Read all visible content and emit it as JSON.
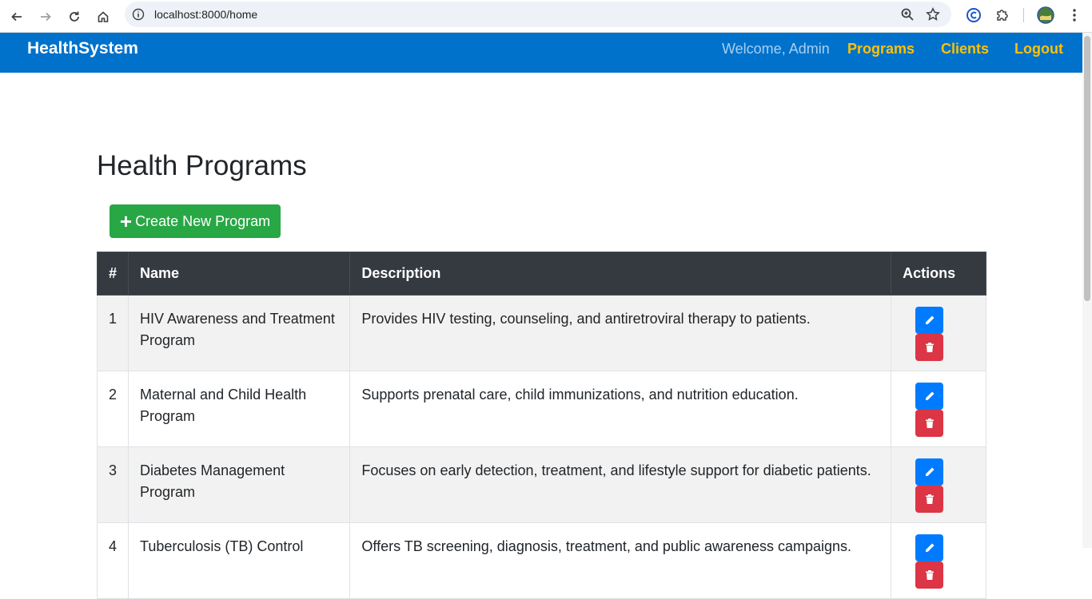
{
  "browser": {
    "url": "localhost:8000/home"
  },
  "navbar": {
    "brand": "HealthSystem",
    "welcome": "Welcome, Admin",
    "links": [
      {
        "label": "Programs"
      },
      {
        "label": "Clients"
      },
      {
        "label": "Logout"
      }
    ]
  },
  "main": {
    "title": "Health Programs",
    "create_button": {
      "icon": "plus-icon",
      "label": "Create New Program"
    },
    "table": {
      "headers": [
        "#",
        "Name",
        "Description",
        "Actions"
      ],
      "rows": [
        {
          "num": "1",
          "name": "HIV Awareness and Treatment Program",
          "description": "Provides HIV testing, counseling, and antiretroviral therapy to patients."
        },
        {
          "num": "2",
          "name": "Maternal and Child Health Program",
          "description": "Supports prenatal care, child immunizations, and nutrition education."
        },
        {
          "num": "3",
          "name": "Diabetes Management Program",
          "description": "Focuses on early detection, treatment, and lifestyle support for diabetic patients."
        },
        {
          "num": "4",
          "name": "Tuberculosis (TB) Control",
          "description": "Offers TB screening, diagnosis, treatment, and public awareness campaigns."
        }
      ],
      "action_icons": {
        "edit": "pencil-icon",
        "delete": "trash-icon"
      }
    }
  },
  "colors": {
    "navbar": "#0072cb",
    "nav_link": "#ffc107",
    "create_button": "#28a745",
    "table_header": "#343a40",
    "edit_button": "#007bff",
    "delete_button": "#dc3545"
  }
}
